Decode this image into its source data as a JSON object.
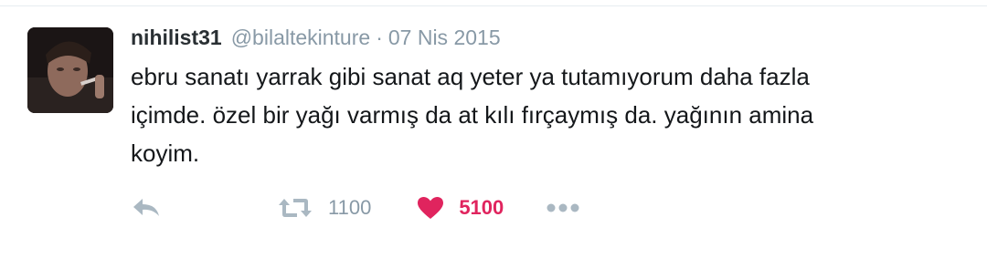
{
  "tweet": {
    "display_name": "nihilist31",
    "handle": "@bilaltekinture",
    "separator": "·",
    "timestamp": "07 Nis 2015",
    "text": "ebru sanatı yarrak gibi sanat aq yeter ya tutamıyorum daha fazla\niçimde. özel bir yağı varmış da at kılı fırçaymış da. yağının amina\nkoyim.",
    "retweet_count": "1100",
    "like_count": "5100"
  },
  "icons": {
    "reply": "reply-icon",
    "retweet": "retweet-icon",
    "like": "heart-icon",
    "more": "more-icon"
  },
  "colors": {
    "name": "#292f33",
    "meta": "#8899a6",
    "text": "#14171a",
    "icon": "#aab8c2",
    "like": "#e0245e"
  }
}
